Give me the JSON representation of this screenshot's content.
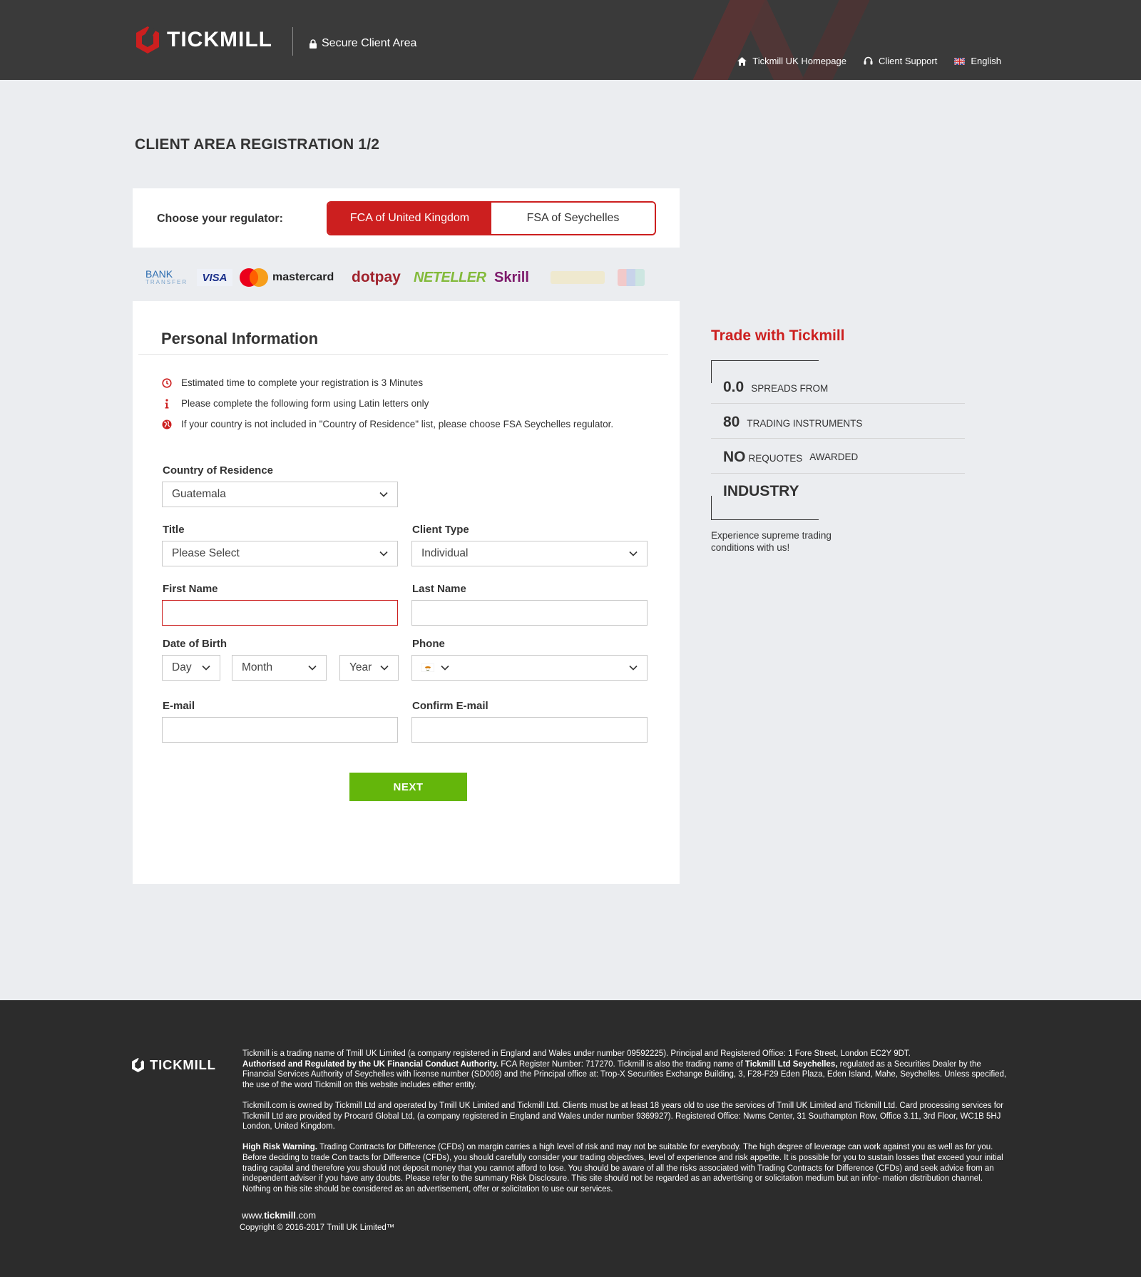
{
  "header": {
    "logo_text": "TICKMILL",
    "secure_label": "Secure Client Area",
    "nav": [
      {
        "label": "Tickmill UK Homepage",
        "icon": "home-icon"
      },
      {
        "label": "Client Support",
        "icon": "headset-icon"
      },
      {
        "label": "English",
        "icon": "uk-flag-icon"
      }
    ]
  },
  "page_title": "CLIENT AREA REGISTRATION 1/2",
  "regulator": {
    "label": "Choose your regulator:",
    "options": [
      "FCA of United Kingdom",
      "FSA of Seychelles"
    ],
    "selected": "FCA of United Kingdom"
  },
  "payments": {
    "bank": "BANK",
    "bank_sub": "TRANSFER",
    "visa": "VISA",
    "mastercard": "mastercard",
    "dotpay": "dotpay",
    "neteller": "NETELLER",
    "skrill": "Skrill"
  },
  "form": {
    "section_title": "Personal Information",
    "notes": [
      "Estimated time to complete your registration is 3 Minutes",
      "Please complete the following form using Latin letters only",
      "If your country is not included in \"Country of Residence\" list, please choose FSA Seychelles regulator."
    ],
    "country": {
      "label": "Country of Residence",
      "value": "Guatemala"
    },
    "title": {
      "label": "Title",
      "value": "Please Select"
    },
    "client_type": {
      "label": "Client Type",
      "value": "Individual"
    },
    "first_name": {
      "label": "First Name",
      "value": ""
    },
    "last_name": {
      "label": "Last Name",
      "value": ""
    },
    "dob": {
      "label": "Date of Birth",
      "day": "Day",
      "month": "Month",
      "year": "Year"
    },
    "phone": {
      "label": "Phone",
      "value": ""
    },
    "email": {
      "label": "E-mail",
      "value": ""
    },
    "confirm_email": {
      "label": "Confirm E-mail",
      "value": ""
    },
    "next_label": "NEXT"
  },
  "sidebar": {
    "title": "Trade with Tickmill",
    "stats": [
      {
        "num": "0.0",
        "label": "SPREADS FROM"
      },
      {
        "num": "80",
        "label": "TRADING INSTRUMENTS"
      },
      {
        "num": "NO",
        "label": "REQUOTES",
        "extra": "AWARDED"
      },
      {
        "num": "INDUSTRY",
        "label": ""
      }
    ],
    "note": "Experience supreme trading conditions with us!"
  },
  "footer": {
    "logo_text": "TICKMILL",
    "p1_a": "Tickmill is a trading name of Tmill UK Limited (a company registered in England and Wales under number 09592225). Principal and Registered Office: 1 Fore Street, London EC2Y 9DT.",
    "p1_b_bold": "Authorised and Regulated by the UK Financial Conduct Authority.",
    "p1_c": " FCA Register Number: 717270. Tickmill is also the trading name of ",
    "p1_d_bold": "Tickmill Ltd Seychelles,",
    "p1_e": " regulated as a Securities Dealer by the Financial Services Authority of Seychelles with license number (SD008) and the Principal office at: Trop-X Securities Exchange Building, 3, F28-F29 Eden Plaza, Eden Island, Mahe, Seychelles. Unless specified, the use of the word Tickmill on this website includes either entity.",
    "p2": "Tickmill.com is owned by Tickmill Ltd and operated by Tmill UK Limited and Tickmill Ltd. Clients must be at least 18 years old to use the services of Tmill UK Limited and Tickmill Ltd. Card processing services for Tickmill Ltd are provided by Procard Global Ltd, (a company registered in England and Wales under number 9369927). Registered Office: Nwms Center, 31 Southampton Row, Office 3.11, 3rd Floor, WC1B 5HJ London, United Kingdom.",
    "p3_bold": "High Risk Warning.",
    "p3": " Trading Contracts for Difference (CFDs) on margin carries a high level of risk and may not be suitable for everybody. The high degree of leverage can work against you as well as for you. Before deciding to trade Con tracts for Difference (CFDs), you should carefully consider your trading objectives, level of experience and risk appetite. It is possible for you to sustain losses that exceed your initial trading capital and therefore you should not deposit money that you cannot afford to lose. You should be aware of all the risks associated with Trading Contracts for Difference (CFDs) and seek advice from an independent adviser if you have any doubts. Please refer to the summary Risk Disclosure. This site should not be regarded as an advertising or solicitation medium but an infor- mation distribution channel. Nothing on this site should be considered as an advertisement, offer or solicitation to use our services.",
    "url_prefix": "www.",
    "url_bold": "tickmill",
    "url_suffix": ".com",
    "copyright": "Copyright © 2016-2017 Tmill UK Limited™"
  },
  "colors": {
    "brand_red": "#cc1f1f",
    "next_green": "#64b60b",
    "header_bg": "#3a3a3a",
    "footer_bg": "#2c2c2c"
  }
}
